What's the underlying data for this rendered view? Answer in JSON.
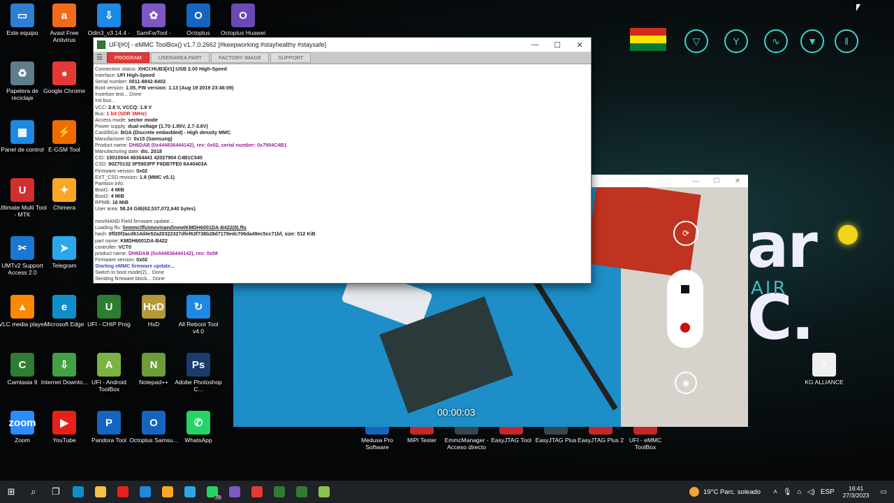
{
  "desktop_icons": [
    {
      "label": "Este equipo",
      "color": "#2d7fd3",
      "glyph": "▭"
    },
    {
      "label": "Avast Free Antivirus",
      "color": "#f26b1d",
      "glyph": "a"
    },
    {
      "label": "Odin3_v3.14.4 -",
      "color": "#1e88e5",
      "glyph": "⇩"
    },
    {
      "label": "SamFwTool -",
      "color": "#7e57c2",
      "glyph": "✿"
    },
    {
      "label": "Octoplus",
      "color": "#1565c0",
      "glyph": "O"
    },
    {
      "label": "Octoplus Huawei",
      "color": "#6a4bb5",
      "glyph": "O"
    },
    {
      "label": "Papelera de reciclaje",
      "color": "#607d8b",
      "glyph": "♻"
    },
    {
      "label": "Google Chrome",
      "color": "#e53935",
      "glyph": "●"
    },
    {
      "label": "Panel de control",
      "color": "#1e88e5",
      "glyph": "▦"
    },
    {
      "label": "E-GSM Tool",
      "color": "#ef6c00",
      "glyph": "⚡"
    },
    {
      "label": "Ultimate Multi Tool - MTK",
      "color": "#d32f2f",
      "glyph": "U"
    },
    {
      "label": "Chimera",
      "color": "#f9a825",
      "glyph": "✦"
    },
    {
      "label": "UMTv2 Support Access 2.0",
      "color": "#1976d2",
      "glyph": "✂"
    },
    {
      "label": "Telegram",
      "color": "#29a9eb",
      "glyph": "➤"
    },
    {
      "label": "VLC media player",
      "color": "#ff8800",
      "glyph": "▲"
    },
    {
      "label": "Microsoft Edge",
      "color": "#0f8fc9",
      "glyph": "e"
    },
    {
      "label": "UFI - CHIP Prog",
      "color": "#2e7d32",
      "glyph": "U"
    },
    {
      "label": "HxD",
      "color": "#b59a3a",
      "glyph": "HxD"
    },
    {
      "label": "All Reboot Tool v4.0",
      "color": "#1e88e5",
      "glyph": "↻"
    },
    {
      "label": "Camtasia 9",
      "color": "#2e7d32",
      "glyph": "C"
    },
    {
      "label": "Internet Downlo...",
      "color": "#43a047",
      "glyph": "⇩"
    },
    {
      "label": "UFI - Android ToolBox",
      "color": "#7cb342",
      "glyph": "A"
    },
    {
      "label": "Notepad++",
      "color": "#6d9c3a",
      "glyph": "N"
    },
    {
      "label": "Adobe Photoshop C...",
      "color": "#1b3b6b",
      "glyph": "Ps"
    },
    {
      "label": "Zoom",
      "color": "#2d8cff",
      "glyph": "zoom"
    },
    {
      "label": "YouTube",
      "color": "#e62117",
      "glyph": "▶"
    },
    {
      "label": "Pandora Tool",
      "color": "#1565c0",
      "glyph": "P"
    },
    {
      "label": "Octoplus Samsu...",
      "color": "#1565c0",
      "glyph": "O"
    },
    {
      "label": "WhatsApp",
      "color": "#25d366",
      "glyph": "✆"
    },
    {
      "label": "Medusa Pro Software",
      "color": "#1565c0",
      "glyph": ""
    },
    {
      "label": "MiPi Tester",
      "color": "#c62828",
      "glyph": ""
    },
    {
      "label": "EmmcManager - Acceso directo",
      "color": "#37474f",
      "glyph": ""
    },
    {
      "label": "EasyJTAG Tool",
      "color": "#c62828",
      "glyph": ""
    },
    {
      "label": "EasyJTAG Plus",
      "color": "#37474f",
      "glyph": ""
    },
    {
      "label": "EasyJTAG Plus 2",
      "color": "#c62828",
      "glyph": ""
    },
    {
      "label": "UFI - eMMC ToolBox",
      "color": "#c62828",
      "glyph": ""
    },
    {
      "label": "KG ALLIANCE",
      "color": "#eeeeee",
      "glyph": "≡"
    }
  ],
  "wallpaper": {
    "brand_text": "ar C.",
    "sub_text": "AIR",
    "flag_colors": [
      "#d52b1e",
      "#f9e300",
      "#007934"
    ]
  },
  "ufi": {
    "title": "UFI[#0] - eMMC ToolBox() v1.7.0.2662 [#keepworking #stayhealthy #staysafe]",
    "tabs": [
      "PROGRAM",
      "USERAREA PART",
      "FACTORY IMAGE",
      "SUPPORT"
    ],
    "minimize": "—",
    "maximize": "☐",
    "close": "✕",
    "log": [
      {
        "k": "Connection status: ",
        "v": "XHCI:HUB3[#1]:USB 2.00 High-Speed",
        "c": "b"
      },
      {
        "k": "Interface: ",
        "v": "UFI High-Speed",
        "c": "b"
      },
      {
        "k": "Serial number: ",
        "v": "0011-8842-8402",
        "c": "b"
      },
      {
        "k": " Boot version: ",
        "v": "1.05, FW version: 1.13 (Aug 19 2019 23:46:09)",
        "c": "b"
      },
      {
        "k": "Insertion test... Done",
        "v": "",
        "c": "b"
      },
      {
        "k": "Init bus...",
        "v": "",
        "c": "b"
      },
      {
        "k": "VCC: ",
        "v": "2.8 V, VCCQ: 1.8 V",
        "c": "b"
      },
      {
        "k": "Bus: ",
        "v": "1 bit (SDR 3MHz)",
        "c": "red"
      },
      {
        "k": "Access mode: ",
        "v": "sector mode",
        "c": "b"
      },
      {
        "k": "Power supply: ",
        "v": "dual-voltage (1.70-1.95V, 2.7-3.6V)",
        "c": "b"
      },
      {
        "k": " Card/BGA: ",
        "v": "BGA (Discrete embedded) - High density MMC",
        "c": "b"
      },
      {
        "k": " Manufacturer ID: ",
        "v": "0x15 (Samsung)",
        "c": "b"
      },
      {
        "k": " Product name: ",
        "v": "DH6DAB (0x444836444142), rev: 0x02, serial number: 0x7904C4B1",
        "c": "pur"
      },
      {
        "k": " Manufacturing date: ",
        "v": "dic. 2018",
        "c": "b"
      },
      {
        "k": "CID: ",
        "v": "15010044 48364441 42027904 C4B1C540",
        "c": "b"
      },
      {
        "k": "CSD: ",
        "v": "90270132 0F5903FF F6DB7FE0 8A40403A",
        "c": "b"
      },
      {
        "k": "Firmware version: ",
        "v": "0x02",
        "c": "b"
      },
      {
        "k": "EXT_CSD revision: ",
        "v": "1.8 (MMC v5.1)",
        "c": "b"
      },
      {
        "k": "Partition info:",
        "v": "",
        "c": "b"
      },
      {
        "k": " Boot1: ",
        "v": "4 MiB",
        "c": "b"
      },
      {
        "k": " Boot2: ",
        "v": "4 MiB",
        "c": "b"
      },
      {
        "k": " RPMB: ",
        "v": "16 MiB",
        "c": "b"
      },
      {
        "k": " User area: ",
        "v": "58.24 GiB(62,537,072,640 bytes)",
        "c": "b"
      },
      {
        "k": "",
        "v": "",
        "c": "b"
      },
      {
        "k": "moviNAND Field firmware update...",
        "v": "",
        "c": "b"
      },
      {
        "k": "Loading ffu: ",
        "v": "\\\\emmc\\ffu\\movinand\\new\\KMDH6001DA-B422(8).ffu",
        "c": "u"
      },
      {
        "k": " hash: ",
        "v": "0ff20f3acd614d4e52a20322327dfef63f738b28d7179edc706da49ec5cc71bf, size: 512 KiB",
        "c": "b"
      },
      {
        "k": " part name: ",
        "v": "KMDH6001DA-B422",
        "c": "b"
      },
      {
        "k": " controller: ",
        "v": "VCT0",
        "c": "b"
      },
      {
        "k": " product name: ",
        "v": "DH6DAB (0x444836444142), rev: 0x08",
        "c": "pur"
      },
      {
        "k": "Firmware version: ",
        "v": "0x02",
        "c": "b"
      },
      {
        "k": "Starting eMMC firmware update...",
        "v": "",
        "c": "blu"
      },
      {
        "k": "Switch to boot mode(2)... Done",
        "v": "",
        "c": "b"
      },
      {
        "k": "Sending firmware block... Done",
        "v": "",
        "c": "b"
      }
    ]
  },
  "camera": {
    "timer": "00:00:03",
    "minimize": "—",
    "maximize": "☐",
    "close": "✕"
  },
  "taskbar": {
    "apps": [
      {
        "name": "start",
        "color": "#ffffff",
        "glyph": "⊞"
      },
      {
        "name": "search",
        "color": "#ffffff",
        "glyph": "⌕"
      },
      {
        "name": "task-view",
        "color": "#ffffff",
        "glyph": "❐"
      },
      {
        "name": "edge",
        "color": "#0f8fc9",
        "glyph": ""
      },
      {
        "name": "file-explorer",
        "color": "#f5c242",
        "glyph": ""
      },
      {
        "name": "youtube",
        "color": "#e62117",
        "glyph": ""
      },
      {
        "name": "control-panel",
        "color": "#1e88e5",
        "glyph": ""
      },
      {
        "name": "chimera",
        "color": "#f9a825",
        "glyph": ""
      },
      {
        "name": "telegram",
        "color": "#29a9eb",
        "glyph": ""
      },
      {
        "name": "whatsapp",
        "color": "#25d366",
        "glyph": ""
      },
      {
        "name": "samfw",
        "color": "#7e57c2",
        "glyph": ""
      },
      {
        "name": "chrome",
        "color": "#e53935",
        "glyph": ""
      },
      {
        "name": "camtasia",
        "color": "#2e7d32",
        "glyph": ""
      },
      {
        "name": "ufi",
        "color": "#2e7d32",
        "glyph": ""
      },
      {
        "name": "ufi-emmc",
        "color": "#8bc34a",
        "glyph": ""
      }
    ],
    "whatsapp_badge": "75",
    "weather": "19°C  Parc. soleado",
    "lang": "ESP",
    "time": "16:41",
    "date": "27/3/2023"
  }
}
